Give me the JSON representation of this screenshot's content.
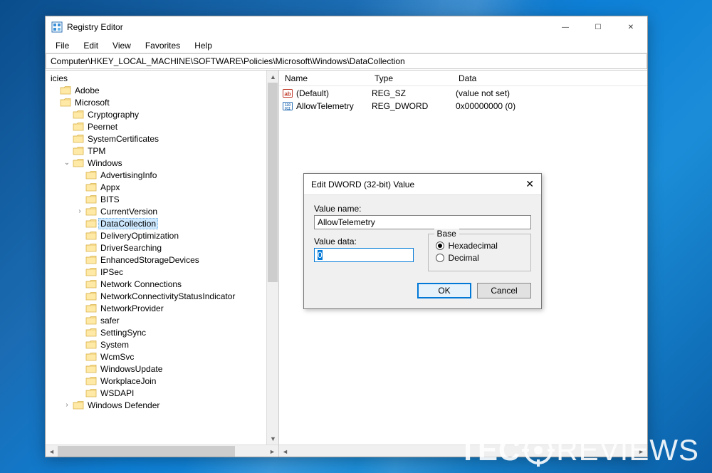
{
  "window": {
    "title": "Registry Editor",
    "menus": [
      "File",
      "Edit",
      "View",
      "Favorites",
      "Help"
    ],
    "controls": {
      "min": "—",
      "max": "☐",
      "close": "✕"
    },
    "address": "Computer\\HKEY_LOCAL_MACHINE\\SOFTWARE\\Policies\\Microsoft\\Windows\\DataCollection"
  },
  "tree": {
    "top_cut": "icies",
    "items": [
      {
        "indent": 0,
        "exp": "",
        "label": "Adobe"
      },
      {
        "indent": 0,
        "exp": "",
        "label": "Microsoft"
      },
      {
        "indent": 1,
        "exp": "",
        "label": "Cryptography"
      },
      {
        "indent": 1,
        "exp": "",
        "label": "Peernet"
      },
      {
        "indent": 1,
        "exp": "",
        "label": "SystemCertificates"
      },
      {
        "indent": 1,
        "exp": "",
        "label": "TPM"
      },
      {
        "indent": 1,
        "exp": "v",
        "label": "Windows"
      },
      {
        "indent": 2,
        "exp": "",
        "label": "AdvertisingInfo"
      },
      {
        "indent": 2,
        "exp": "",
        "label": "Appx"
      },
      {
        "indent": 2,
        "exp": "",
        "label": "BITS"
      },
      {
        "indent": 2,
        "exp": ">",
        "label": "CurrentVersion"
      },
      {
        "indent": 2,
        "exp": "",
        "label": "DataCollection",
        "selected": true
      },
      {
        "indent": 2,
        "exp": "",
        "label": "DeliveryOptimization"
      },
      {
        "indent": 2,
        "exp": "",
        "label": "DriverSearching"
      },
      {
        "indent": 2,
        "exp": "",
        "label": "EnhancedStorageDevices"
      },
      {
        "indent": 2,
        "exp": "",
        "label": "IPSec"
      },
      {
        "indent": 2,
        "exp": "",
        "label": "Network Connections"
      },
      {
        "indent": 2,
        "exp": "",
        "label": "NetworkConnectivityStatusIndicator"
      },
      {
        "indent": 2,
        "exp": "",
        "label": "NetworkProvider"
      },
      {
        "indent": 2,
        "exp": "",
        "label": "safer"
      },
      {
        "indent": 2,
        "exp": "",
        "label": "SettingSync"
      },
      {
        "indent": 2,
        "exp": "",
        "label": "System"
      },
      {
        "indent": 2,
        "exp": "",
        "label": "WcmSvc"
      },
      {
        "indent": 2,
        "exp": "",
        "label": "WindowsUpdate"
      },
      {
        "indent": 2,
        "exp": "",
        "label": "WorkplaceJoin"
      },
      {
        "indent": 2,
        "exp": "",
        "label": "WSDAPI"
      },
      {
        "indent": 1,
        "exp": ">",
        "label": "Windows Defender"
      }
    ]
  },
  "list": {
    "headers": {
      "name": "Name",
      "type": "Type",
      "data": "Data"
    },
    "rows": [
      {
        "icon": "string",
        "name": "(Default)",
        "type": "REG_SZ",
        "data": "(value not set)"
      },
      {
        "icon": "binary",
        "name": "AllowTelemetry",
        "type": "REG_DWORD",
        "data": "0x00000000 (0)"
      }
    ]
  },
  "dialog": {
    "title": "Edit DWORD (32-bit) Value",
    "labels": {
      "value_name": "Value name:",
      "value_data": "Value data:",
      "base": "Base"
    },
    "value_name": "AllowTelemetry",
    "value_data": "0",
    "base_options": {
      "hex": "Hexadecimal",
      "dec": "Decimal"
    },
    "buttons": {
      "ok": "OK",
      "cancel": "Cancel"
    }
  },
  "watermark": {
    "left": "TEC",
    "right": "REVIEWS"
  }
}
